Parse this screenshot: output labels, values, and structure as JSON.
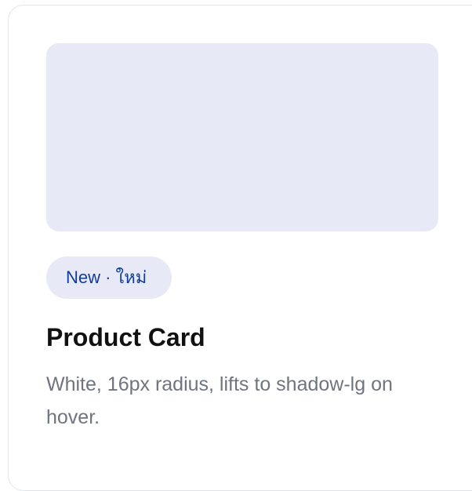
{
  "card": {
    "badge": "New · ใหม่",
    "title": "Product Card",
    "description": "White, 16px radius, lifts to shadow-lg on hover."
  },
  "colors": {
    "card_background": "#ffffff",
    "card_border": "#e6e7eb",
    "media_placeholder": "#e7eaf6",
    "badge_background": "#e7eaf6",
    "badge_text": "#123c9a",
    "title_text": "#111111",
    "description_text": "#6f7480"
  }
}
